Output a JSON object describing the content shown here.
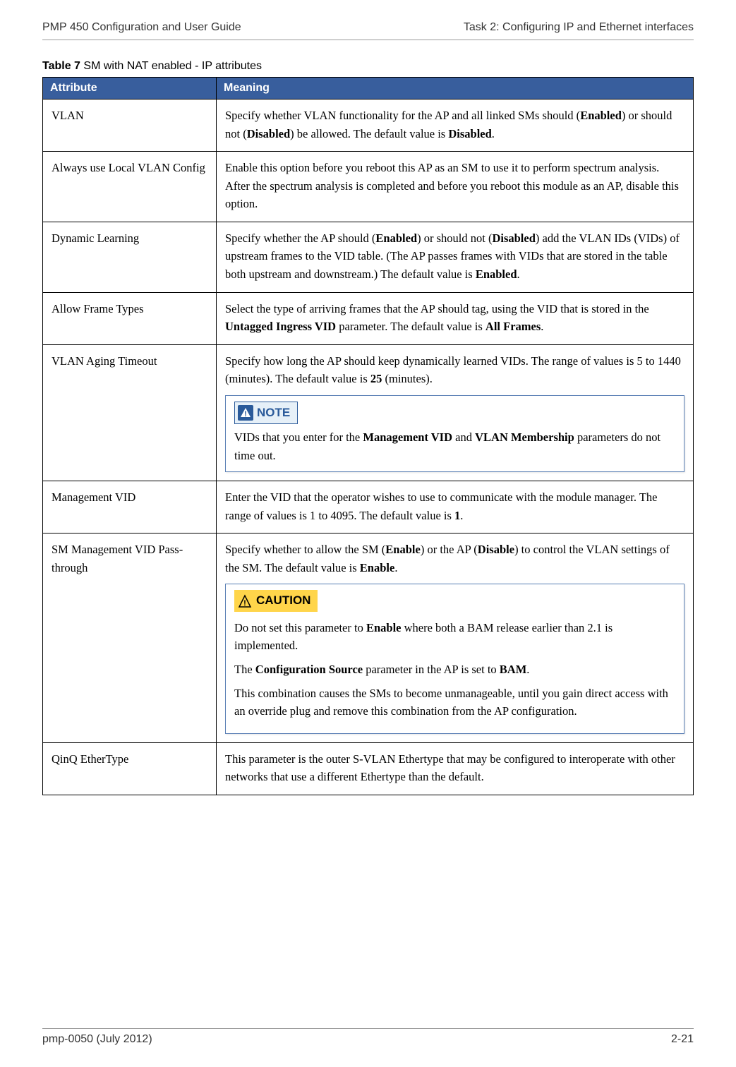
{
  "header": {
    "left": "PMP 450 Configuration and User Guide",
    "right": "Task 2: Configuring IP and Ethernet interfaces"
  },
  "caption": {
    "bold": "Table 7",
    "rest": "  SM with NAT enabled - IP attributes"
  },
  "columns": {
    "attr": "Attribute",
    "meaning": "Meaning"
  },
  "rows": {
    "vlan": {
      "attr": "VLAN",
      "text1": "Specify whether VLAN functionality for the AP and all linked SMs should (",
      "b1": "Enabled",
      "text2": ") or should not (",
      "b2": "Disabled",
      "text3": ") be allowed. The default value is ",
      "b3": "Disabled",
      "text4": "."
    },
    "local": {
      "attr": "Always use Local VLAN Config",
      "text": "Enable this option before you reboot this AP as an SM to use it to perform spectrum analysis. After the spectrum analysis is completed and before you reboot this module as an AP, disable this option."
    },
    "dynamic": {
      "attr": "Dynamic Learning",
      "t1": "Specify whether the AP should (",
      "b1": "Enabled",
      "t2": ") or should not (",
      "b2": "Disabled",
      "t3": ") add the VLAN IDs (VIDs) of upstream frames to the VID table. (The AP passes frames with VIDs that are stored in the table both upstream and downstream.) The default value is ",
      "b3": "Enabled",
      "t4": "."
    },
    "allow": {
      "attr": "Allow Frame Types",
      "t1": "Select the type of arriving frames that the AP should tag, using the VID that is stored in the ",
      "b1": "Untagged Ingress VID",
      "t2": " parameter. The default value is ",
      "b2": "All Frames",
      "t3": "."
    },
    "aging": {
      "attr": "VLAN Aging Timeout",
      "t1": "Specify how long the AP should keep dynamically learned VIDs. The range of values is 5 to 1440 (minutes). The default value is ",
      "b1": "25",
      "t2": " (minutes).",
      "note_label": "NOTE",
      "note_t1": "VIDs that you enter for the ",
      "note_b1": "Management VID",
      "note_t2": " and ",
      "note_b2": "VLAN Membership",
      "note_t3": " parameters do not time out."
    },
    "mgmt": {
      "attr": "Management VID",
      "t1": "Enter the VID that the operator wishes to use to communicate with the module manager. The range of values is 1 to 4095. The default value is ",
      "b1": "1",
      "t2": "."
    },
    "passthrough": {
      "attr": "SM Management VID Pass-through",
      "t1": "Specify whether to allow the SM (",
      "b1": "Enable",
      "t2": ") or the AP (",
      "b2": "Disable",
      "t3": ") to control the VLAN settings of the SM. The default value is ",
      "b3": "Enable",
      "t4": ".",
      "caution_label": "CAUTION",
      "c_t1": "Do not set this parameter to ",
      "c_b1": "Enable",
      "c_t2": " where both a BAM release earlier than 2.1 is implemented.",
      "c_t3": "The ",
      "c_b2": "Configuration Source",
      "c_t4": " parameter in the AP is set to ",
      "c_b3": "BAM",
      "c_t5": ".",
      "c_t6": "This combination causes the SMs to become unmanageable, until you gain direct access with an override plug and remove this combination from the AP configuration."
    },
    "qinq": {
      "attr": "QinQ EtherType",
      "text": "This parameter is the outer S-VLAN Ethertype that may be configured to interoperate with other networks that use a different Ethertype than the default."
    }
  },
  "footer": {
    "left": "pmp-0050 (July 2012)",
    "right": "2-21"
  }
}
